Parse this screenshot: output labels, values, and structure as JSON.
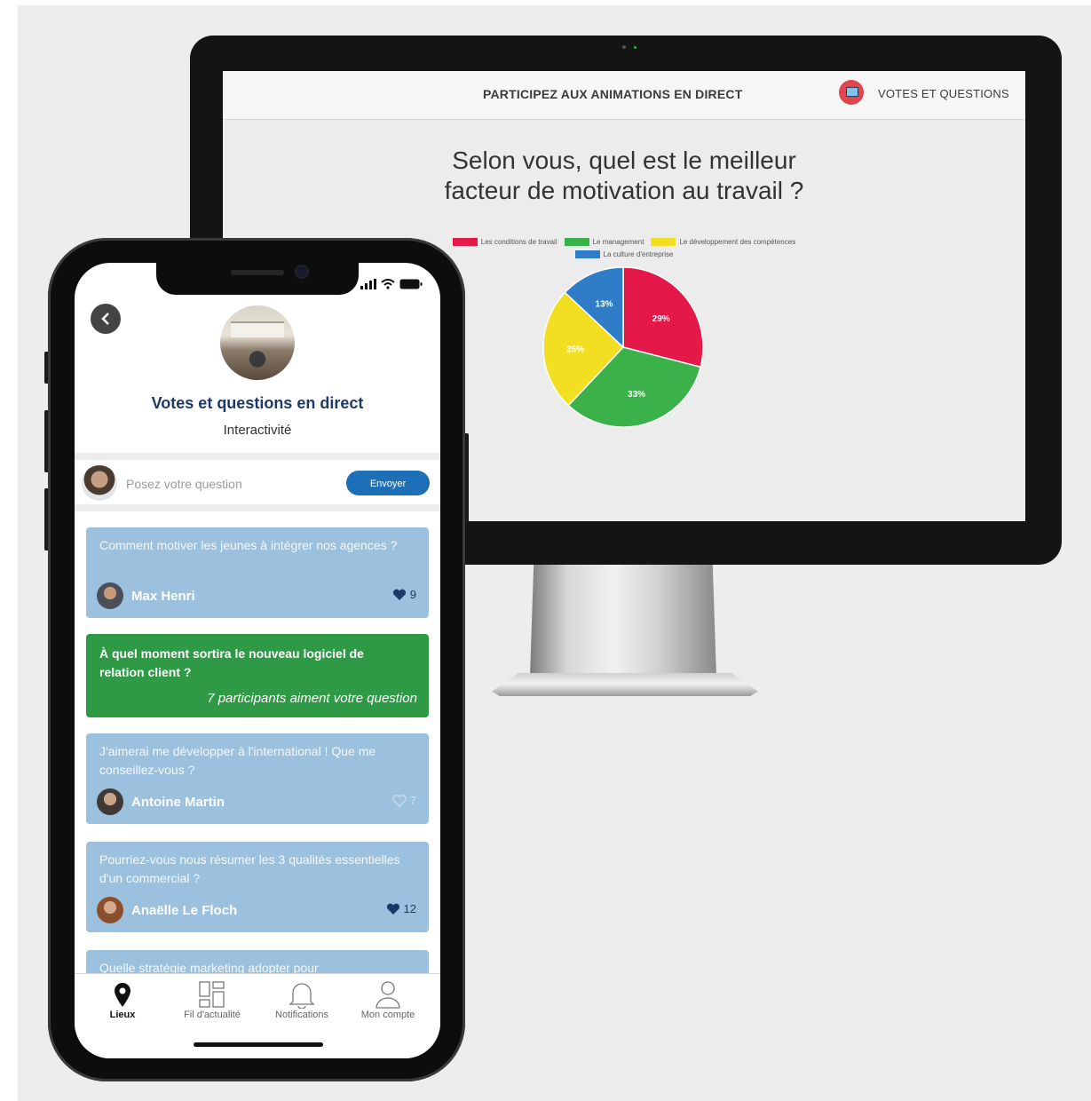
{
  "colors": {
    "accent_blue": "#1d6fb8",
    "card_blue": "#9cc1de",
    "card_green": "#2f9a45",
    "title_navy": "#1d3a66"
  },
  "desktop": {
    "header_title": "PARTICIPEZ AUX ANIMATIONS EN DIRECT",
    "votes_label": "VOTES ET QUESTIONS",
    "question_line1": "Selon vous, quel est le meilleur",
    "question_line2": "facteur de motivation au travail ?"
  },
  "chart_data": {
    "type": "pie",
    "series": [
      {
        "name": "Les conditions de travail",
        "value": 29,
        "label": "29%",
        "color": "#e5184a"
      },
      {
        "name": "Le management",
        "value": 33,
        "label": "33%",
        "color": "#3bb14a"
      },
      {
        "name": "Le développement des compétences",
        "value": 25,
        "label": "25%",
        "color": "#f2df22"
      },
      {
        "name": "La culture d'entreprise",
        "value": 13,
        "label": "13%",
        "color": "#2f7dc6"
      }
    ],
    "legend_position": "top"
  },
  "phone": {
    "title": "Votes et questions en direct",
    "subtitle": "Interactivité",
    "ask_placeholder": "Posez votre question",
    "send_label": "Envoyer",
    "cards": [
      {
        "question": "Comment motiver les jeunes à intégrer nos agences ?",
        "author": "Max Henri",
        "likes": "9",
        "liked": true
      },
      {
        "question": "À quel moment sortira le nouveau logiciel de relation client ?",
        "note": "7 participants aiment votre question"
      },
      {
        "question": "J'aimerai me développer à l'international ! Que me conseillez-vous ?",
        "author": "Antoine Martin",
        "likes": "7",
        "liked": false
      },
      {
        "question": "Pourriez-vous nous résumer les 3 qualités essentielles d'un commercial ?",
        "author": "Anaëlle Le Floch",
        "likes": "12",
        "liked": true
      },
      {
        "question": "Quelle stratégie marketing adopter pour"
      }
    ],
    "tabs": [
      {
        "label": "Lieux",
        "icon": "map-pin-icon"
      },
      {
        "label": "Fil d'actualité",
        "icon": "grid-icon"
      },
      {
        "label": "Notifications",
        "icon": "bell-icon"
      },
      {
        "label": "Mon compte",
        "icon": "user-icon"
      }
    ]
  }
}
